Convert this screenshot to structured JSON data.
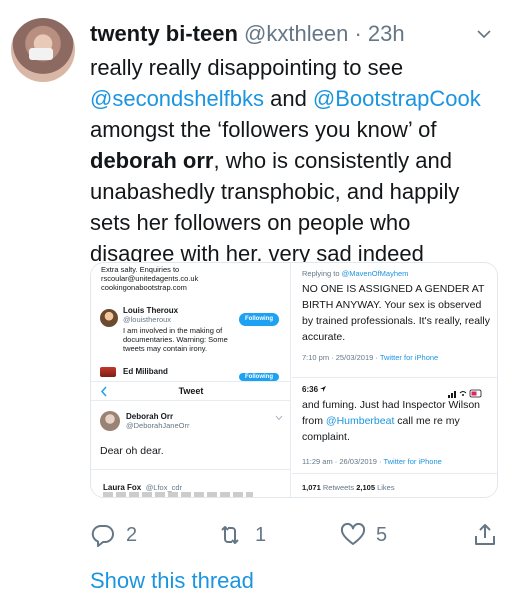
{
  "tweet": {
    "display_name": "twenty bi-teen",
    "handle": "@kxthleen",
    "separator": "·",
    "time": "23h",
    "text": {
      "p1": "really really disappointing to see",
      "mention1": "@secondshelfbks",
      "and": " and ",
      "mention2": "@BootstrapCook",
      "p2": "amongst the ‘followers you know’ of",
      "bold_name": "deborah orr",
      "p3": ", who is consistently and unabashedly transphobic, and happily sets her followers on people who disagree with her. very sad indeed"
    }
  },
  "media": {
    "left": {
      "top_lines": [
        "Extra salty. Enquiries to",
        "rscoular@unitedagents.co.uk",
        "cookingonabootstrap.com"
      ],
      "user1": {
        "name": "Louis Theroux",
        "handle": "@louistheroux",
        "bio": "I am involved in the making of documentaries. Warning: Some tweets may contain irony.",
        "button": "Following"
      },
      "user2": {
        "name": "Ed Miliband",
        "button": "Following"
      },
      "tweet_header": "Tweet",
      "deborah": {
        "name": "Deborah Orr",
        "handle": "@DeborahJaneOrr",
        "text": "Dear oh dear."
      },
      "laura": {
        "name": "Laura Fox",
        "handle": "@Lfox_cdr"
      }
    },
    "right_top": {
      "replying_prefix": "Replying to ",
      "replying_handle": "@MavenOfMayhem",
      "text": "NO ONE IS ASSIGNED A GENDER AT BIRTH ANYWAY. Your sex is observed by trained professionals. It's really, really accurate.",
      "meta_time": "7:10 pm · 25/03/2019 · ",
      "meta_source": "Twitter for iPhone"
    },
    "right_bottom": {
      "status_time": "6:36",
      "text_pre": "and fuming. Just had Inspector Wilson from ",
      "mention": "@Humberbeat",
      "text_post": " call me re my complaint.",
      "meta_time": "11:29 am · 26/03/2019 · ",
      "meta_source": "Twitter for iPhone",
      "retweets_count": "1,071",
      "retweets_label": " Retweets  ",
      "likes_count": "2,105",
      "likes_label": " Likes"
    }
  },
  "actions": {
    "reply_count": "2",
    "retweet_count": "1",
    "like_count": "5"
  },
  "show_thread": "Show this thread",
  "colors": {
    "link": "#1b95e0",
    "muted": "#657786",
    "text": "#14171a",
    "accent": "#1da1f2"
  }
}
